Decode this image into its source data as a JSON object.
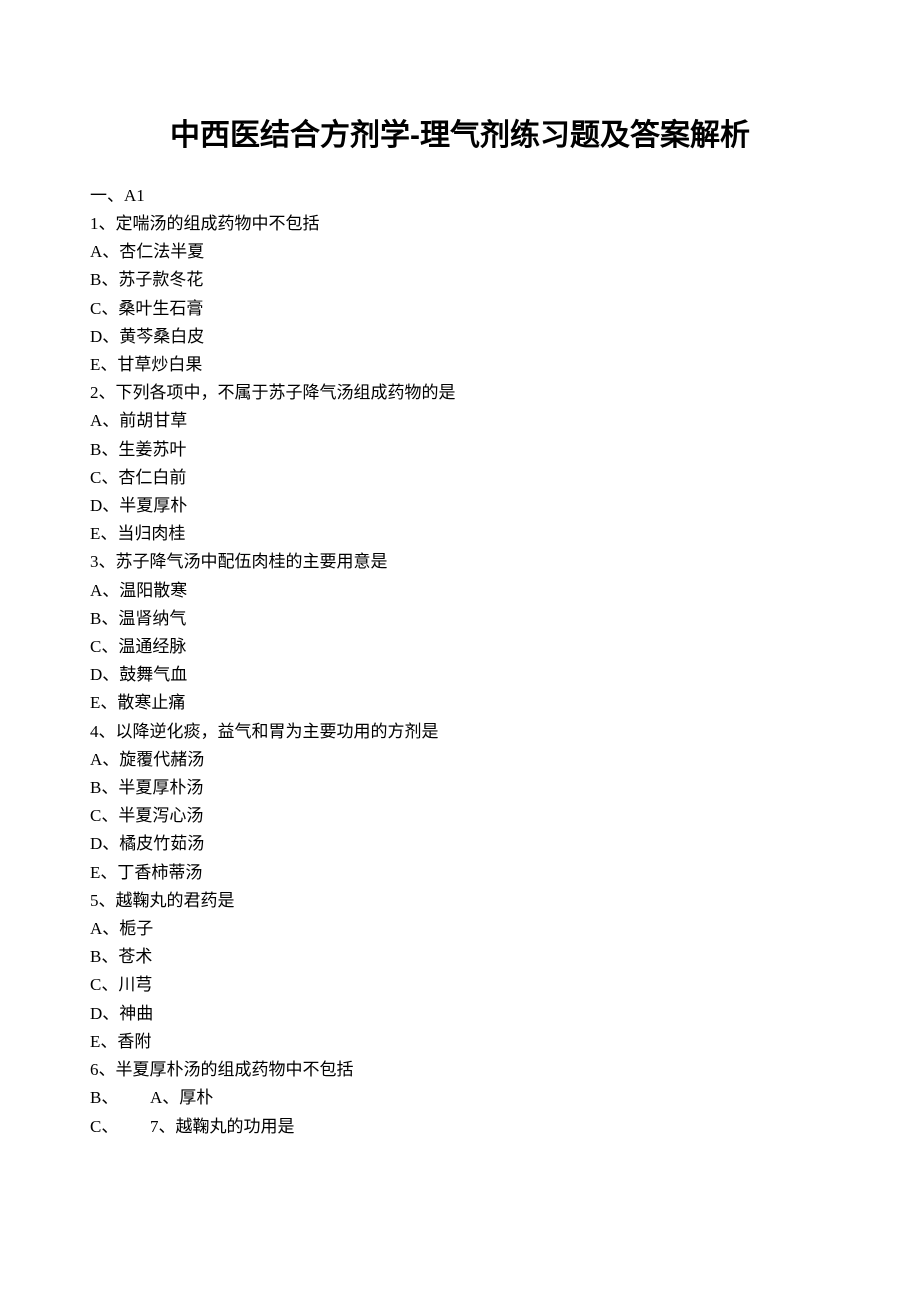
{
  "title": "中西医结合方剂学-理气剂练习题及答案解析",
  "section": "一、A1",
  "q1": {
    "stem": "1、定喘汤的组成药物中不包括",
    "a": "A、杏仁法半夏",
    "b": "B、苏子款冬花",
    "c": "C、桑叶生石膏",
    "d": "D、黄芩桑白皮",
    "e": "E、甘草炒白果"
  },
  "q2": {
    "stem": "2、下列各项中，不属于苏子降气汤组成药物的是",
    "a": "A、前胡甘草",
    "b": "B、生姜苏叶",
    "c": "C、杏仁白前",
    "d": "D、半夏厚朴",
    "e": "E、当归肉桂"
  },
  "q3": {
    "stem": "3、苏子降气汤中配伍肉桂的主要用意是",
    "a": "A、温阳散寒",
    "b": "B、温肾纳气",
    "c": "C、温通经脉",
    "d": "D、鼓舞气血",
    "e": "E、散寒止痛"
  },
  "q4": {
    "stem": "4、以降逆化痰，益气和胃为主要功用的方剂是",
    "a": "A、旋覆代赭汤",
    "b": "B、半夏厚朴汤",
    "c": "C、半夏泻心汤",
    "d": "D、橘皮竹茹汤",
    "e": "E、丁香柿蒂汤"
  },
  "q5": {
    "stem": "5、越鞠丸的君药是",
    "a": "A、栀子",
    "b": "B、苍术",
    "c": "C、川芎",
    "d": "D、神曲",
    "e": "E、香附"
  },
  "q6": {
    "stem": "6、半夏厚朴汤的组成药物中不包括",
    "b_label": "B、",
    "b_content": "A、厚朴",
    "c_label": "C、",
    "c_content": "7、越鞠丸的功用是"
  }
}
